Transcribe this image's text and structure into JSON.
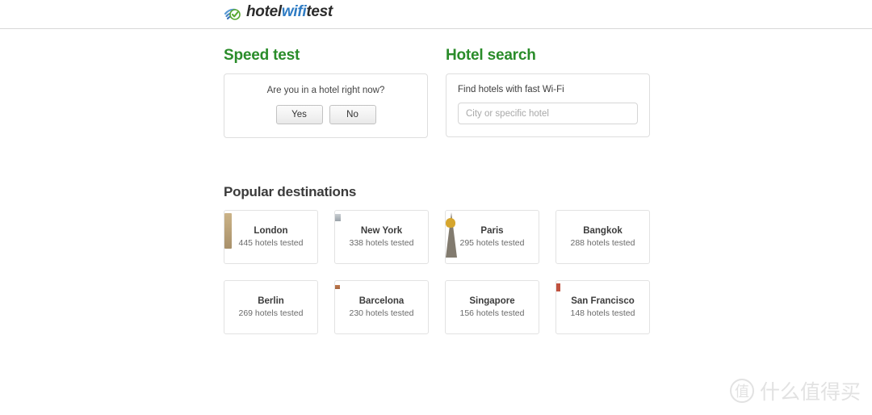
{
  "header": {
    "logo_icon": "wifi-check-icon",
    "brand_part1": "hotel",
    "brand_part2": "wifi",
    "brand_part3": "test"
  },
  "speed_test": {
    "title": "Speed test",
    "prompt": "Are you in a hotel right now?",
    "yes_label": "Yes",
    "no_label": "No"
  },
  "hotel_search": {
    "title": "Hotel search",
    "field_label": "Find hotels with fast Wi-Fi",
    "input_value": "",
    "input_placeholder": "City or specific hotel"
  },
  "destinations": {
    "title": "Popular destinations",
    "count_suffix": "hotels tested",
    "items": [
      {
        "name": "London",
        "count": "445",
        "count_text": "445 hotels tested",
        "photo": "london-photo"
      },
      {
        "name": "New York",
        "count": "338",
        "count_text": "338 hotels tested",
        "photo": "newyork-photo"
      },
      {
        "name": "Paris",
        "count": "295",
        "count_text": "295 hotels tested",
        "photo": "paris-photo"
      },
      {
        "name": "Bangkok",
        "count": "288",
        "count_text": "288 hotels tested",
        "photo": "bangkok-photo"
      },
      {
        "name": "Berlin",
        "count": "269",
        "count_text": "269 hotels tested",
        "photo": "berlin-photo"
      },
      {
        "name": "Barcelona",
        "count": "230",
        "count_text": "230 hotels tested",
        "photo": "barcelona-photo"
      },
      {
        "name": "Singapore",
        "count": "156",
        "count_text": "156 hotels tested",
        "photo": "singapore-photo"
      },
      {
        "name": "San Francisco",
        "count": "148",
        "count_text": "148 hotels tested",
        "photo": "sanfrancisco-photo"
      }
    ]
  },
  "watermark": {
    "badge": "值",
    "text": "什么值得买"
  },
  "colors": {
    "brand_blue": "#2f7cc4",
    "section_green": "#2a8c2a",
    "border": "#dedede",
    "text_dark": "#3c3c3c",
    "text_muted": "#6a6a6a"
  }
}
